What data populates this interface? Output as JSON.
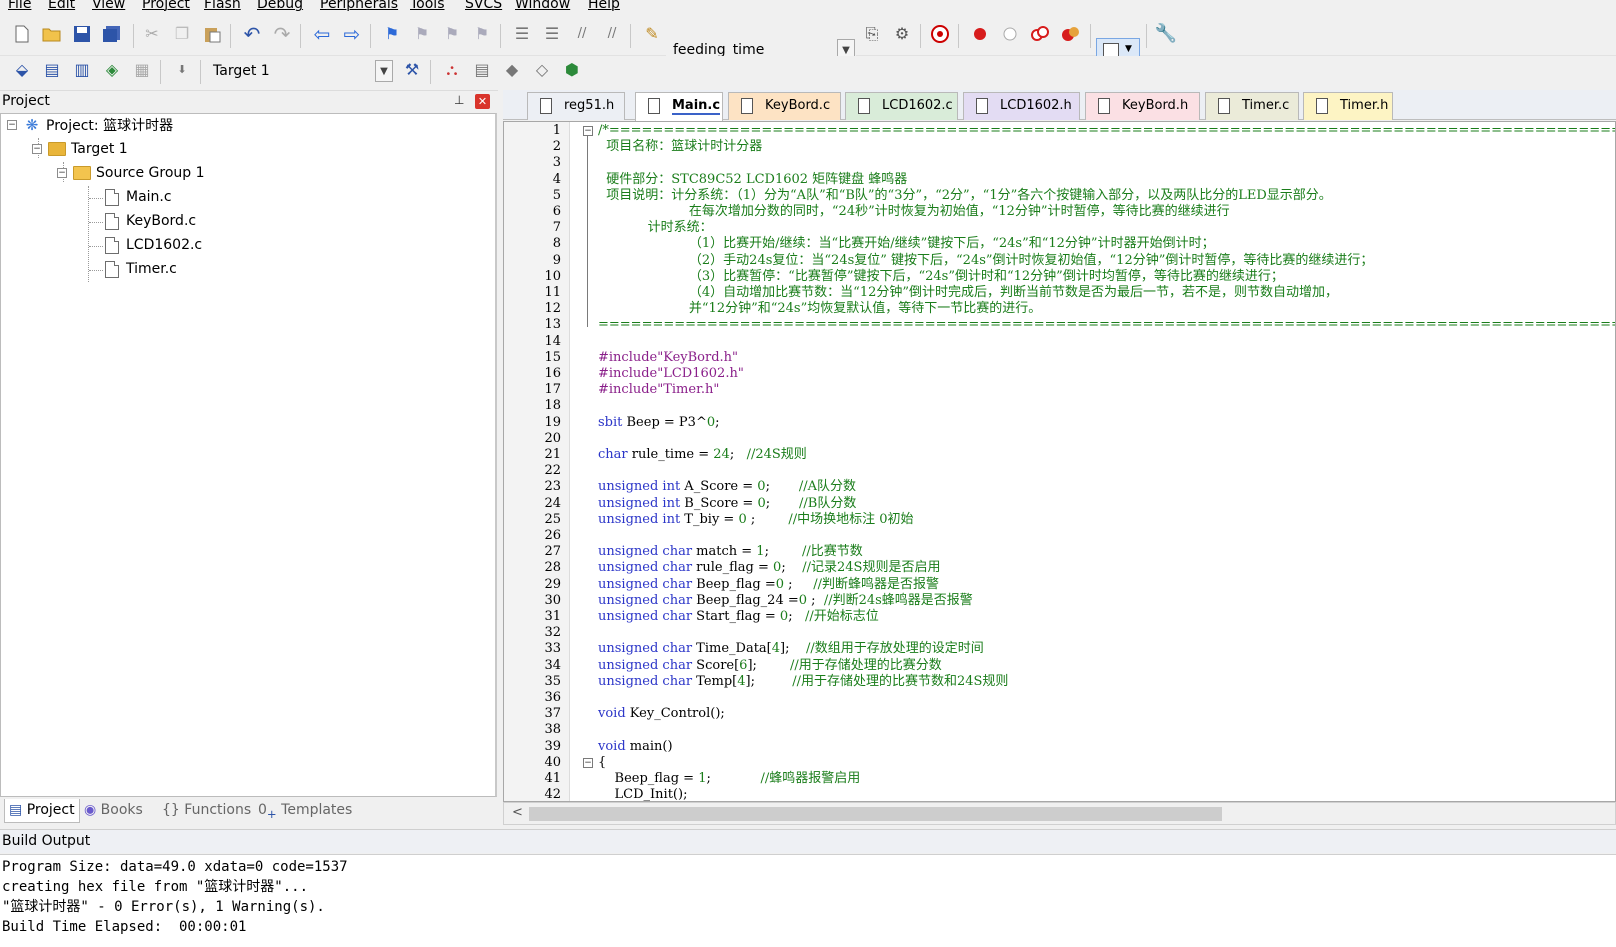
{
  "menu": [
    "File",
    "Edit",
    "View",
    "Project",
    "Flash",
    "Debug",
    "Peripherals",
    "Tools",
    "SVCS",
    "Window",
    "Help"
  ],
  "toolbar1": {
    "target_file": "feeding_time"
  },
  "toolbar2": {
    "target_select": "Target 1"
  },
  "project_panel": {
    "title": "Project",
    "root": "Project: 篮球计时器",
    "target": "Target 1",
    "group": "Source Group 1",
    "files": [
      "Main.c",
      "KeyBord.c",
      "LCD1602.c",
      "Timer.c"
    ],
    "tabs": [
      "Project",
      "Books",
      "Functions",
      "Templates"
    ]
  },
  "file_tabs": [
    {
      "name": "reg51.h",
      "color": "#eceff4"
    },
    {
      "name": "Main.c",
      "color": "#ffffff"
    },
    {
      "name": "KeyBord.c",
      "color": "#fde3c4"
    },
    {
      "name": "LCD1602.c",
      "color": "#d9ecd9"
    },
    {
      "name": "LCD1602.h",
      "color": "#e3dcf3"
    },
    {
      "name": "KeyBord.h",
      "color": "#fbe0e4"
    },
    {
      "name": "Timer.c",
      "color": "#ebebd9"
    },
    {
      "name": "Timer.h",
      "color": "#fdf4c4"
    }
  ],
  "code_lines": [
    [
      [
        "cm",
        "/*=================================================================================================================="
      ]
    ],
    [
      [
        "cm",
        "  项目名称：篮球计时计分器"
      ]
    ],
    [
      [
        "cm",
        ""
      ]
    ],
    [
      [
        "cm",
        "  硬件部分：STC89C52 LCD1602 矩阵键盘 蜂鸣器"
      ]
    ],
    [
      [
        "cm",
        "  项目说明：计分系统：（1）分为“A队”和“B队”的“3分”，“2分”，“1分”各六个按键输入部分，以及两队比分的LED显示部分。"
      ]
    ],
    [
      [
        "cm",
        "                      在每次增加分数的同时，“24秒”计时恢复为初始值，“12分钟”计时暂停，等待比赛的继续进行"
      ]
    ],
    [
      [
        "cm",
        "            计时系统："
      ]
    ],
    [
      [
        "cm",
        "                      （1）比赛开始/继续：当“比赛开始/继续”键按下后，“24s”和“12分钟”计时器开始倒计时；"
      ]
    ],
    [
      [
        "cm",
        "                      （2）手动24s复位：当“24s复位” 键按下后，“24s”倒计时恢复初始值，“12分钟”倒计时暂停，等待比赛的继续进行；"
      ]
    ],
    [
      [
        "cm",
        "                      （3）比赛暂停：“比赛暂停”键按下后，“24s”倒计时和“12分钟”倒计时均暂停，等待比赛的继续进行；"
      ]
    ],
    [
      [
        "cm",
        "                      （4）自动增加比赛节数：当“12分钟”倒计时完成后，判断当前节数是否为最后一节，若不是，则节数自动增加，"
      ]
    ],
    [
      [
        "cm",
        "                      并“12分钟”和“24s”均恢复默认值，等待下一节比赛的进行。"
      ]
    ],
    [
      [
        "cm",
        "==================================================================================================================*/"
      ]
    ],
    [
      [
        "p",
        ""
      ]
    ],
    [
      [
        "s",
        "#include\"KeyBord.h\""
      ]
    ],
    [
      [
        "s",
        "#include\"LCD1602.h\""
      ]
    ],
    [
      [
        "s",
        "#include\"Timer.h\""
      ]
    ],
    [
      [
        "p",
        ""
      ]
    ],
    [
      [
        "k",
        "sbit"
      ],
      [
        "p",
        " Beep = P3^"
      ],
      [
        "n",
        "0"
      ],
      [
        "p",
        ";"
      ]
    ],
    [
      [
        "p",
        ""
      ]
    ],
    [
      [
        "k",
        "char"
      ],
      [
        "p",
        " rule_time = "
      ],
      [
        "n",
        "24"
      ],
      [
        "p",
        ";   "
      ],
      [
        "cm",
        "//24S规则"
      ]
    ],
    [
      [
        "p",
        ""
      ]
    ],
    [
      [
        "k",
        "unsigned int"
      ],
      [
        "p",
        " A_Score = "
      ],
      [
        "n",
        "0"
      ],
      [
        "p",
        ";       "
      ],
      [
        "cm",
        "//A队分数"
      ]
    ],
    [
      [
        "k",
        "unsigned int"
      ],
      [
        "p",
        " B_Score = "
      ],
      [
        "n",
        "0"
      ],
      [
        "p",
        ";       "
      ],
      [
        "cm",
        "//B队分数"
      ]
    ],
    [
      [
        "k",
        "unsigned int"
      ],
      [
        "p",
        " T_biy = "
      ],
      [
        "n",
        "0"
      ],
      [
        "p",
        " ;        "
      ],
      [
        "cm",
        "//中场换地标注 0初始"
      ]
    ],
    [
      [
        "p",
        ""
      ]
    ],
    [
      [
        "k",
        "unsigned char"
      ],
      [
        "p",
        " match = "
      ],
      [
        "n",
        "1"
      ],
      [
        "p",
        ";        "
      ],
      [
        "cm",
        "//比赛节数"
      ]
    ],
    [
      [
        "k",
        "unsigned char"
      ],
      [
        "p",
        " rule_flag = "
      ],
      [
        "n",
        "0"
      ],
      [
        "p",
        ";    "
      ],
      [
        "cm",
        "//记录24S规则是否启用"
      ]
    ],
    [
      [
        "k",
        "unsigned char"
      ],
      [
        "p",
        " Beep_flag ="
      ],
      [
        "n",
        "0"
      ],
      [
        "p",
        " ;     "
      ],
      [
        "cm",
        "//判断蜂鸣器是否报警"
      ]
    ],
    [
      [
        "k",
        "unsigned char"
      ],
      [
        "p",
        " Beep_flag_24 ="
      ],
      [
        "n",
        "0"
      ],
      [
        "p",
        " ;  "
      ],
      [
        "cm",
        "//判断24s蜂鸣器是否报警"
      ]
    ],
    [
      [
        "k",
        "unsigned char"
      ],
      [
        "p",
        " Start_flag = "
      ],
      [
        "n",
        "0"
      ],
      [
        "p",
        ";   "
      ],
      [
        "cm",
        "//开始标志位"
      ]
    ],
    [
      [
        "p",
        ""
      ]
    ],
    [
      [
        "k",
        "unsigned char"
      ],
      [
        "p",
        " Time_Data["
      ],
      [
        "n",
        "4"
      ],
      [
        "p",
        "];    "
      ],
      [
        "cm",
        "//数组用于存放处理的设定时间"
      ]
    ],
    [
      [
        "k",
        "unsigned char"
      ],
      [
        "p",
        " Score["
      ],
      [
        "n",
        "6"
      ],
      [
        "p",
        "];        "
      ],
      [
        "cm",
        "//用于存储处理的比赛分数"
      ]
    ],
    [
      [
        "k",
        "unsigned char"
      ],
      [
        "p",
        " Temp["
      ],
      [
        "n",
        "4"
      ],
      [
        "p",
        "];         "
      ],
      [
        "cm",
        "//用于存储处理的比赛节数和24S规则"
      ]
    ],
    [
      [
        "p",
        ""
      ]
    ],
    [
      [
        "k",
        "void"
      ],
      [
        "p",
        " Key_Control();"
      ]
    ],
    [
      [
        "p",
        ""
      ]
    ],
    [
      [
        "k",
        "void"
      ],
      [
        "p",
        " main()"
      ]
    ],
    [
      [
        "p",
        "{"
      ]
    ],
    [
      [
        "p",
        "    Beep_flag = "
      ],
      [
        "n",
        "1"
      ],
      [
        "p",
        ";            "
      ],
      [
        "cm",
        "//蜂鸣器报警启用"
      ]
    ],
    [
      [
        "p",
        "    LCD_Init();"
      ]
    ]
  ],
  "build_output": {
    "title": "Build Output",
    "lines": [
      "Program Size: data=49.0 xdata=0 code=1537",
      "creating hex file from \"篮球计时器\"...",
      "\"篮球计时器\" - 0 Error(s), 1 Warning(s).",
      "Build Time Elapsed:  00:00:01"
    ]
  }
}
